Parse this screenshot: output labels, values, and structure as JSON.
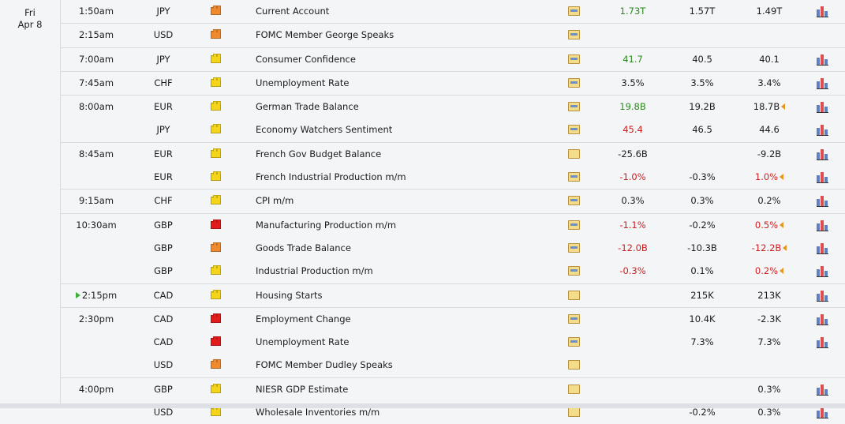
{
  "date": {
    "day": "Fri",
    "date": "Apr 8"
  },
  "rows": [
    {
      "time": "1:50am",
      "currency": "JPY",
      "impact": "med",
      "title": "Current Account",
      "detail_graph": true,
      "actual": "1.73T",
      "actual_class": "pos",
      "forecast": "1.57T",
      "previous": "1.49T",
      "previous_class": "",
      "revised": false,
      "chart": true
    },
    {
      "time": "2:15am",
      "currency": "USD",
      "impact": "med",
      "title": "FOMC Member George Speaks",
      "detail_graph": true,
      "actual": "",
      "actual_class": "",
      "forecast": "",
      "previous": "",
      "previous_class": "",
      "revised": false,
      "chart": false
    },
    {
      "time": "7:00am",
      "currency": "JPY",
      "impact": "low",
      "title": "Consumer Confidence",
      "detail_graph": true,
      "actual": "41.7",
      "actual_class": "pos",
      "forecast": "40.5",
      "previous": "40.1",
      "previous_class": "",
      "revised": false,
      "chart": true
    },
    {
      "time": "7:45am",
      "currency": "CHF",
      "impact": "low",
      "title": "Unemployment Rate",
      "detail_graph": true,
      "actual": "3.5%",
      "actual_class": "",
      "forecast": "3.5%",
      "previous": "3.4%",
      "previous_class": "",
      "revised": false,
      "chart": true
    },
    {
      "time": "8:00am",
      "currency": "EUR",
      "impact": "low",
      "title": "German Trade Balance",
      "detail_graph": true,
      "actual": "19.8B",
      "actual_class": "pos",
      "forecast": "19.2B",
      "previous": "18.7B",
      "previous_class": "",
      "revised": true,
      "chart": true
    },
    {
      "time": "",
      "currency": "JPY",
      "impact": "low",
      "title": "Economy Watchers Sentiment",
      "detail_graph": true,
      "actual": "45.4",
      "actual_class": "neg",
      "forecast": "46.5",
      "previous": "44.6",
      "previous_class": "",
      "revised": false,
      "chart": true
    },
    {
      "time": "8:45am",
      "currency": "EUR",
      "impact": "low",
      "title": "French Gov Budget Balance",
      "detail_graph": false,
      "actual": "-25.6B",
      "actual_class": "",
      "forecast": "",
      "previous": "-9.2B",
      "previous_class": "",
      "revised": false,
      "chart": true
    },
    {
      "time": "",
      "currency": "EUR",
      "impact": "low",
      "title": "French Industrial Production m/m",
      "detail_graph": true,
      "actual": "-1.0%",
      "actual_class": "neg",
      "forecast": "-0.3%",
      "previous": "1.0%",
      "previous_class": "neg",
      "revised": true,
      "chart": true
    },
    {
      "time": "9:15am",
      "currency": "CHF",
      "impact": "low",
      "title": "CPI m/m",
      "detail_graph": true,
      "actual": "0.3%",
      "actual_class": "",
      "forecast": "0.3%",
      "previous": "0.2%",
      "previous_class": "",
      "revised": false,
      "chart": true
    },
    {
      "time": "10:30am",
      "currency": "GBP",
      "impact": "high",
      "title": "Manufacturing Production m/m",
      "detail_graph": true,
      "actual": "-1.1%",
      "actual_class": "neg",
      "forecast": "-0.2%",
      "previous": "0.5%",
      "previous_class": "neg",
      "revised": true,
      "chart": true
    },
    {
      "time": "",
      "currency": "GBP",
      "impact": "med",
      "title": "Goods Trade Balance",
      "detail_graph": true,
      "actual": "-12.0B",
      "actual_class": "neg",
      "forecast": "-10.3B",
      "previous": "-12.2B",
      "previous_class": "neg",
      "revised": true,
      "chart": true
    },
    {
      "time": "",
      "currency": "GBP",
      "impact": "low",
      "title": "Industrial Production m/m",
      "detail_graph": true,
      "actual": "-0.3%",
      "actual_class": "neg",
      "forecast": "0.1%",
      "previous": "0.2%",
      "previous_class": "neg",
      "revised": true,
      "chart": true
    },
    {
      "time": "2:15pm",
      "current": true,
      "currency": "CAD",
      "impact": "low",
      "title": "Housing Starts",
      "detail_graph": false,
      "actual": "",
      "actual_class": "",
      "forecast": "215K",
      "previous": "213K",
      "previous_class": "",
      "revised": false,
      "chart": true
    },
    {
      "time": "2:30pm",
      "currency": "CAD",
      "impact": "high",
      "title": "Employment Change",
      "detail_graph": true,
      "actual": "",
      "actual_class": "",
      "forecast": "10.4K",
      "previous": "-2.3K",
      "previous_class": "",
      "revised": false,
      "chart": true
    },
    {
      "time": "",
      "currency": "CAD",
      "impact": "high",
      "title": "Unemployment Rate",
      "detail_graph": true,
      "actual": "",
      "actual_class": "",
      "forecast": "7.3%",
      "previous": "7.3%",
      "previous_class": "",
      "revised": false,
      "chart": true
    },
    {
      "time": "",
      "currency": "USD",
      "impact": "med",
      "title": "FOMC Member Dudley Speaks",
      "detail_graph": false,
      "actual": "",
      "actual_class": "",
      "forecast": "",
      "previous": "",
      "previous_class": "",
      "revised": false,
      "chart": false
    },
    {
      "time": "4:00pm",
      "currency": "GBP",
      "impact": "low",
      "title": "NIESR GDP Estimate",
      "detail_graph": false,
      "actual": "",
      "actual_class": "",
      "forecast": "",
      "previous": "0.3%",
      "previous_class": "",
      "revised": false,
      "chart": true
    },
    {
      "time": "",
      "currency": "USD",
      "impact": "low",
      "title": "Wholesale Inventories m/m",
      "detail_graph": false,
      "actual": "",
      "actual_class": "",
      "forecast": "-0.2%",
      "previous": "0.3%",
      "previous_class": "",
      "revised": false,
      "chart": true
    }
  ]
}
